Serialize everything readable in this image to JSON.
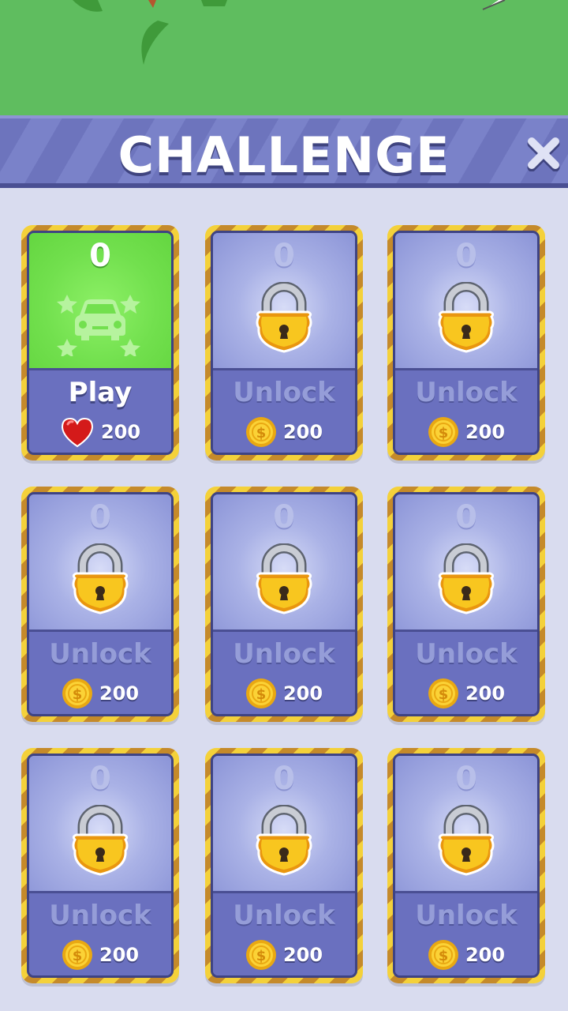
{
  "header": {
    "title": "CHALLENGE"
  },
  "close_icon": "close-icon",
  "colors": {
    "background": "#d9dcef",
    "header": "#6d74bd",
    "card_unlocked_top": "#72e04e",
    "card_locked_top": "#aab2e6",
    "card_bottom": "#6a70bf",
    "gold_border": "#f4d13a"
  },
  "cards": [
    {
      "count": "0",
      "action": "Play",
      "price": "200",
      "currency_icon": "heart-icon",
      "state": "unlocked",
      "emblem_icon": "car-icon"
    },
    {
      "count": "0",
      "action": "Unlock",
      "price": "200",
      "currency_icon": "coin-icon",
      "state": "locked",
      "emblem_icon": "lock-icon"
    },
    {
      "count": "0",
      "action": "Unlock",
      "price": "200",
      "currency_icon": "coin-icon",
      "state": "locked",
      "emblem_icon": "lock-icon"
    },
    {
      "count": "0",
      "action": "Unlock",
      "price": "200",
      "currency_icon": "coin-icon",
      "state": "locked",
      "emblem_icon": "lock-icon"
    },
    {
      "count": "0",
      "action": "Unlock",
      "price": "200",
      "currency_icon": "coin-icon",
      "state": "locked",
      "emblem_icon": "lock-icon"
    },
    {
      "count": "0",
      "action": "Unlock",
      "price": "200",
      "currency_icon": "coin-icon",
      "state": "locked",
      "emblem_icon": "lock-icon"
    },
    {
      "count": "0",
      "action": "Unlock",
      "price": "200",
      "currency_icon": "coin-icon",
      "state": "locked",
      "emblem_icon": "lock-icon"
    },
    {
      "count": "0",
      "action": "Unlock",
      "price": "200",
      "currency_icon": "coin-icon",
      "state": "locked",
      "emblem_icon": "lock-icon"
    },
    {
      "count": "0",
      "action": "Unlock",
      "price": "200",
      "currency_icon": "coin-icon",
      "state": "locked",
      "emblem_icon": "lock-icon"
    }
  ]
}
